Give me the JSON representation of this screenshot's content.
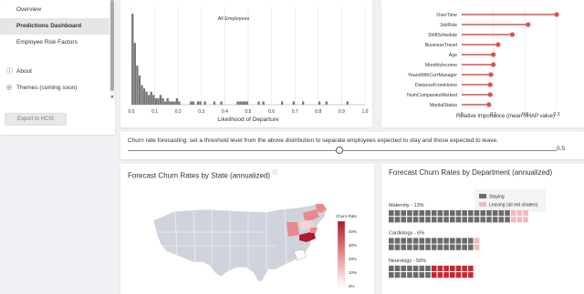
{
  "sidebar": {
    "items": [
      {
        "label": "Overview",
        "active": false
      },
      {
        "label": "Predictions Dashboard",
        "active": true
      },
      {
        "label": "Employee Risk Factors",
        "active": false
      }
    ],
    "about_label": "About",
    "themes_label": "Themes (coming soon)",
    "export_label": "Export to HCIS"
  },
  "histogram": {
    "chart_data": {
      "type": "bar",
      "title": "All Employees",
      "xlabel": "Likelihood of Departure",
      "xlim": [
        0,
        1
      ],
      "xticks": [
        "0.0",
        "0.1",
        "0.2",
        "0.3",
        "0.4",
        "0.5",
        "0.6",
        "0.7",
        "0.8",
        "0.9",
        "1.0"
      ],
      "bins": [
        {
          "x": 0.005,
          "count": 28
        },
        {
          "x": 0.015,
          "count": 19
        },
        {
          "x": 0.025,
          "count": 12
        },
        {
          "x": 0.035,
          "count": 9
        },
        {
          "x": 0.045,
          "count": 6
        },
        {
          "x": 0.055,
          "count": 5
        },
        {
          "x": 0.065,
          "count": 4
        },
        {
          "x": 0.075,
          "count": 3
        },
        {
          "x": 0.085,
          "count": 4
        },
        {
          "x": 0.095,
          "count": 3
        },
        {
          "x": 0.105,
          "count": 2
        },
        {
          "x": 0.115,
          "count": 2
        },
        {
          "x": 0.125,
          "count": 3
        },
        {
          "x": 0.135,
          "count": 2
        },
        {
          "x": 0.145,
          "count": 1
        },
        {
          "x": 0.155,
          "count": 2
        },
        {
          "x": 0.165,
          "count": 1
        },
        {
          "x": 0.175,
          "count": 1
        },
        {
          "x": 0.185,
          "count": 1
        },
        {
          "x": 0.195,
          "count": 2
        },
        {
          "x": 0.205,
          "count": 1
        },
        {
          "x": 0.255,
          "count": 1
        },
        {
          "x": 0.265,
          "count": 1
        },
        {
          "x": 0.285,
          "count": 1
        },
        {
          "x": 0.295,
          "count": 1
        },
        {
          "x": 0.315,
          "count": 1
        },
        {
          "x": 0.355,
          "count": 1
        },
        {
          "x": 0.385,
          "count": 1
        },
        {
          "x": 0.455,
          "count": 1
        },
        {
          "x": 0.465,
          "count": 1
        },
        {
          "x": 0.475,
          "count": 1
        },
        {
          "x": 0.485,
          "count": 1
        },
        {
          "x": 0.495,
          "count": 1
        },
        {
          "x": 0.545,
          "count": 1
        },
        {
          "x": 0.565,
          "count": 1
        },
        {
          "x": 0.645,
          "count": 1
        },
        {
          "x": 0.695,
          "count": 1
        },
        {
          "x": 0.735,
          "count": 1
        },
        {
          "x": 0.805,
          "count": 1
        },
        {
          "x": 0.835,
          "count": 1
        },
        {
          "x": 0.925,
          "count": 1
        }
      ],
      "ylim": [
        0,
        30
      ],
      "bar_color": "#777777"
    }
  },
  "shap": {
    "chart_data": {
      "type": "lollipop",
      "xlabel": "Relative Importance (mean SHAP value)",
      "xlim": [
        0,
        0.3
      ],
      "xticks": [
        "0",
        "0.1",
        "0.2",
        "0.3"
      ],
      "categories": [
        "OverTime",
        "JobRole",
        "ShiftSchedule",
        "BusinessTravel",
        "Age",
        "MonthlyIncome",
        "YearsWithCurrManager",
        "DistanceFromHome",
        "NumCompaniesWorked",
        "MaritalStatus"
      ],
      "values": [
        0.3,
        0.21,
        0.16,
        0.115,
        0.1,
        0.1,
        0.092,
        0.09,
        0.09,
        0.086
      ],
      "color": "#d9534f"
    }
  },
  "slider": {
    "label": "Churn rate forecasting: set a threshold level from the above distribution to separate employees expected to stay and those expected to leave.",
    "value": "0.5",
    "fraction": 0.5
  },
  "map": {
    "title": "Forecast Churn Rates by State (annualized)",
    "legend_title": "Churn Rate",
    "legend_ticks": [
      "40%",
      "30%",
      "20%",
      "10%",
      "0%"
    ],
    "colors": {
      "base": "#cfd4dc",
      "high": "#b2182b",
      "mid": "#e8898b",
      "low": "#f6d3d3",
      "zero": "#ffffff"
    }
  },
  "waffle": {
    "title": "Forecast Churn Rates by Department (annualized)",
    "legend": [
      {
        "label": "Staying",
        "color": "#6b6b6b"
      },
      {
        "label": "Leaving (all red shades)",
        "color": "#f2b8bd"
      }
    ],
    "departments": [
      {
        "label": "Maternity - 13%",
        "stay": 20,
        "leave": 3,
        "leave_color": "#f2b8bd"
      },
      {
        "label": "Cardiology - 6%",
        "stay": 14,
        "leave": 1,
        "leave_color": "#f2b8bd"
      },
      {
        "label": "Neurology - 50%",
        "stay": 7,
        "leave": 7,
        "leave_color": "#d0242f"
      }
    ]
  }
}
